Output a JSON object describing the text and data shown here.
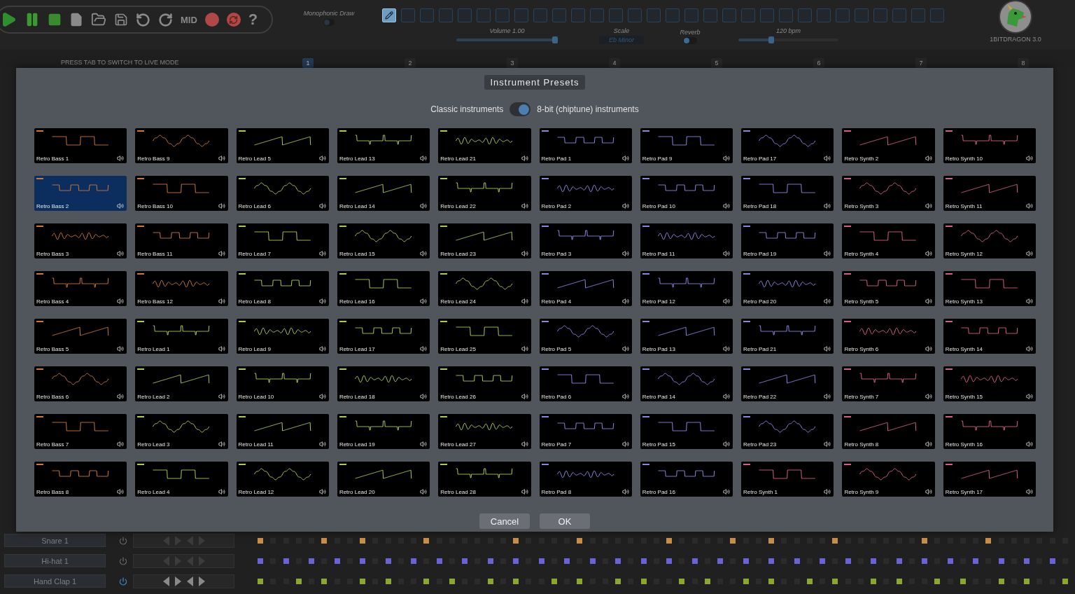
{
  "toolbar": {
    "mid_label": "MID",
    "help_label": "?"
  },
  "monophonic_draw": {
    "label": "Monophonic Draw",
    "on": false
  },
  "steps": [
    {
      "selected": true
    },
    {
      "selected": false
    },
    {
      "selected": false
    },
    {
      "selected": false
    },
    {
      "selected": false
    },
    {
      "selected": false
    },
    {
      "selected": false
    },
    {
      "selected": false
    },
    {
      "selected": false
    },
    {
      "selected": false
    },
    {
      "selected": false
    },
    {
      "selected": false
    },
    {
      "selected": false
    },
    {
      "selected": false
    },
    {
      "selected": false
    },
    {
      "selected": false
    },
    {
      "selected": false
    },
    {
      "selected": false
    },
    {
      "selected": false
    },
    {
      "selected": false
    },
    {
      "selected": false
    },
    {
      "selected": false
    },
    {
      "selected": false
    },
    {
      "selected": false
    },
    {
      "selected": false
    },
    {
      "selected": false
    },
    {
      "selected": false
    },
    {
      "selected": false
    },
    {
      "selected": false
    },
    {
      "selected": false
    }
  ],
  "volume": {
    "label": "Volume 1.00",
    "level": 0.97
  },
  "scale": {
    "label": "Scale",
    "value": "Eb Minor"
  },
  "reverb": {
    "label": "Reverb",
    "on": false
  },
  "tempo": {
    "label": "120 bpm",
    "level": 0.33
  },
  "logo": {
    "caption": "1BITDRAGON 3.0"
  },
  "hint": "PRESS TAB TO SWITCH TO LIVE MODE",
  "bars": [
    {
      "label": "1",
      "selected": true
    },
    {
      "label": "2",
      "selected": false
    },
    {
      "label": "3",
      "selected": false
    },
    {
      "label": "4",
      "selected": false
    },
    {
      "label": "5",
      "selected": false
    },
    {
      "label": "6",
      "selected": false
    },
    {
      "label": "7",
      "selected": false
    },
    {
      "label": "8",
      "selected": false
    }
  ],
  "dialog": {
    "title": "Instrument Presets",
    "mode_switch": {
      "left_label": "Classic instruments",
      "right_label": "8-bit (chiptune) instruments",
      "on": true
    },
    "presets": [
      {
        "name": "Retro Bass 1",
        "selected": false,
        "color": "#c8783c"
      },
      {
        "name": "Retro Bass 9",
        "selected": false,
        "color": "#c8783c"
      },
      {
        "name": "Retro Lead 5",
        "selected": false,
        "color": "#a8cc50"
      },
      {
        "name": "Retro Lead 13",
        "selected": false,
        "color": "#a8cc50"
      },
      {
        "name": "Retro Lead 21",
        "selected": false,
        "color": "#a8cc50"
      },
      {
        "name": "Retro Pad 1",
        "selected": false,
        "color": "#8a86e0"
      },
      {
        "name": "Retro Pad 9",
        "selected": false,
        "color": "#8a86e0"
      },
      {
        "name": "Retro Pad 17",
        "selected": false,
        "color": "#8a86e0"
      },
      {
        "name": "Retro Synth 2",
        "selected": false,
        "color": "#d0608a"
      },
      {
        "name": "Retro Synth 10",
        "selected": false,
        "color": "#d0608a"
      },
      {
        "name": "Retro Bass 2",
        "selected": true,
        "color": "#c8783c"
      },
      {
        "name": "Retro Bass 10",
        "selected": false,
        "color": "#c8783c"
      },
      {
        "name": "Retro Lead 6",
        "selected": false,
        "color": "#a8cc50"
      },
      {
        "name": "Retro Lead 14",
        "selected": false,
        "color": "#a8cc50"
      },
      {
        "name": "Retro Lead 22",
        "selected": false,
        "color": "#a8cc50"
      },
      {
        "name": "Retro Pad 2",
        "selected": false,
        "color": "#8a86e0"
      },
      {
        "name": "Retro Pad 10",
        "selected": false,
        "color": "#8a86e0"
      },
      {
        "name": "Retro Pad 18",
        "selected": false,
        "color": "#8a86e0"
      },
      {
        "name": "Retro Synth 3",
        "selected": false,
        "color": "#d0608a"
      },
      {
        "name": "Retro Synth 11",
        "selected": false,
        "color": "#d0608a"
      },
      {
        "name": "Retro Bass 3",
        "selected": false,
        "color": "#c8783c"
      },
      {
        "name": "Retro Bass 11",
        "selected": false,
        "color": "#c8783c"
      },
      {
        "name": "Retro Lead 7",
        "selected": false,
        "color": "#a8cc50"
      },
      {
        "name": "Retro Lead 15",
        "selected": false,
        "color": "#a8cc50"
      },
      {
        "name": "Retro Lead 23",
        "selected": false,
        "color": "#a8cc50"
      },
      {
        "name": "Retro Pad 3",
        "selected": false,
        "color": "#8a86e0"
      },
      {
        "name": "Retro Pad 11",
        "selected": false,
        "color": "#8a86e0"
      },
      {
        "name": "Retro Pad 19",
        "selected": false,
        "color": "#8a86e0"
      },
      {
        "name": "Retro Synth 4",
        "selected": false,
        "color": "#d0608a"
      },
      {
        "name": "Retro Synth 12",
        "selected": false,
        "color": "#d0608a"
      },
      {
        "name": "Retro Bass 4",
        "selected": false,
        "color": "#c8783c"
      },
      {
        "name": "Retro Bass 12",
        "selected": false,
        "color": "#c8783c"
      },
      {
        "name": "Retro Lead 8",
        "selected": false,
        "color": "#a8cc50"
      },
      {
        "name": "Retro Lead 16",
        "selected": false,
        "color": "#a8cc50"
      },
      {
        "name": "Retro Lead 24",
        "selected": false,
        "color": "#a8cc50"
      },
      {
        "name": "Retro Pad 4",
        "selected": false,
        "color": "#8a86e0"
      },
      {
        "name": "Retro Pad 12",
        "selected": false,
        "color": "#8a86e0"
      },
      {
        "name": "Retro Pad 20",
        "selected": false,
        "color": "#8a86e0"
      },
      {
        "name": "Retro Synth 5",
        "selected": false,
        "color": "#d0608a"
      },
      {
        "name": "Retro Synth 13",
        "selected": false,
        "color": "#d0608a"
      },
      {
        "name": "Retro Bass 5",
        "selected": false,
        "color": "#c8783c"
      },
      {
        "name": "Retro Lead 1",
        "selected": false,
        "color": "#a8cc50"
      },
      {
        "name": "Retro Lead 9",
        "selected": false,
        "color": "#a8cc50"
      },
      {
        "name": "Retro Lead 17",
        "selected": false,
        "color": "#a8cc50"
      },
      {
        "name": "Retro Lead 25",
        "selected": false,
        "color": "#a8cc50"
      },
      {
        "name": "Retro Pad 5",
        "selected": false,
        "color": "#8a86e0"
      },
      {
        "name": "Retro Pad 13",
        "selected": false,
        "color": "#8a86e0"
      },
      {
        "name": "Retro Pad 21",
        "selected": false,
        "color": "#8a86e0"
      },
      {
        "name": "Retro Synth 6",
        "selected": false,
        "color": "#d0608a"
      },
      {
        "name": "Retro Synth 14",
        "selected": false,
        "color": "#d0608a"
      },
      {
        "name": "Retro Bass 6",
        "selected": false,
        "color": "#c8783c"
      },
      {
        "name": "Retro Lead 2",
        "selected": false,
        "color": "#a8cc50"
      },
      {
        "name": "Retro Lead 10",
        "selected": false,
        "color": "#a8cc50"
      },
      {
        "name": "Retro Lead 18",
        "selected": false,
        "color": "#a8cc50"
      },
      {
        "name": "Retro Lead 26",
        "selected": false,
        "color": "#a8cc50"
      },
      {
        "name": "Retro Pad 6",
        "selected": false,
        "color": "#8a86e0"
      },
      {
        "name": "Retro Pad 14",
        "selected": false,
        "color": "#8a86e0"
      },
      {
        "name": "Retro Pad 22",
        "selected": false,
        "color": "#8a86e0"
      },
      {
        "name": "Retro Synth 7",
        "selected": false,
        "color": "#d0608a"
      },
      {
        "name": "Retro Synth 15",
        "selected": false,
        "color": "#d0608a"
      },
      {
        "name": "Retro Bass 7",
        "selected": false,
        "color": "#c8783c"
      },
      {
        "name": "Retro Lead 3",
        "selected": false,
        "color": "#a8cc50"
      },
      {
        "name": "Retro Lead 11",
        "selected": false,
        "color": "#a8cc50"
      },
      {
        "name": "Retro Lead 19",
        "selected": false,
        "color": "#a8cc50"
      },
      {
        "name": "Retro Lead 27",
        "selected": false,
        "color": "#a8cc50"
      },
      {
        "name": "Retro Pad 7",
        "selected": false,
        "color": "#8a86e0"
      },
      {
        "name": "Retro Pad 15",
        "selected": false,
        "color": "#8a86e0"
      },
      {
        "name": "Retro Pad 23",
        "selected": false,
        "color": "#8a86e0"
      },
      {
        "name": "Retro Synth 8",
        "selected": false,
        "color": "#d0608a"
      },
      {
        "name": "Retro Synth 16",
        "selected": false,
        "color": "#d0608a"
      },
      {
        "name": "Retro Bass 8",
        "selected": false,
        "color": "#c8783c"
      },
      {
        "name": "Retro Lead 4",
        "selected": false,
        "color": "#a8cc50"
      },
      {
        "name": "Retro Lead 12",
        "selected": false,
        "color": "#a8cc50"
      },
      {
        "name": "Retro Lead 20",
        "selected": false,
        "color": "#a8cc50"
      },
      {
        "name": "Retro Lead 28",
        "selected": false,
        "color": "#a8cc50"
      },
      {
        "name": "Retro Pad 8",
        "selected": false,
        "color": "#8a86e0"
      },
      {
        "name": "Retro Pad 16",
        "selected": false,
        "color": "#8a86e0"
      },
      {
        "name": "Retro Synth 1",
        "selected": false,
        "color": "#d0608a"
      },
      {
        "name": "Retro Synth 9",
        "selected": false,
        "color": "#d0608a"
      },
      {
        "name": "Retro Synth 17",
        "selected": false,
        "color": "#d0608a"
      }
    ],
    "buttons": [
      "Cancel",
      "OK"
    ]
  },
  "tracks": [
    {
      "name": "Snare 1",
      "on": false,
      "color": "#c8904a",
      "steps": [
        true,
        false,
        false,
        false,
        false,
        true,
        false,
        false,
        true,
        false,
        false,
        false,
        false,
        true,
        false,
        false,
        false,
        false,
        false,
        false,
        true,
        false,
        false,
        false,
        false,
        true,
        false,
        false,
        false,
        false,
        false,
        false,
        true,
        false,
        false,
        false,
        false,
        true,
        false,
        false,
        true,
        false,
        false,
        false,
        false,
        true,
        false,
        false,
        false,
        false,
        false,
        false,
        true,
        false,
        false,
        false,
        false,
        true,
        false,
        false,
        false,
        false,
        false,
        false
      ]
    },
    {
      "name": "Hi-hat 1",
      "on": false,
      "color": "#6a62d8",
      "steps": [
        true,
        false,
        true,
        false,
        true,
        false,
        true,
        false,
        true,
        false,
        true,
        false,
        true,
        false,
        true,
        false,
        true,
        false,
        true,
        false,
        true,
        false,
        true,
        false,
        true,
        false,
        true,
        false,
        true,
        false,
        true,
        false,
        true,
        false,
        true,
        false,
        true,
        false,
        true,
        false,
        true,
        false,
        true,
        false,
        true,
        false,
        true,
        false,
        true,
        false,
        true,
        false,
        true,
        false,
        true,
        false,
        true,
        false,
        true,
        false,
        true,
        false,
        true,
        false
      ]
    },
    {
      "name": "Hand Clap 1",
      "on": true,
      "color": "#8aa830",
      "steps": [
        true,
        false,
        false,
        true,
        false,
        true,
        false,
        false,
        true,
        false,
        true,
        false,
        false,
        true,
        false,
        true,
        false,
        false,
        true,
        false,
        true,
        false,
        false,
        true,
        false,
        true,
        false,
        false,
        true,
        false,
        true,
        false,
        false,
        true,
        false,
        true,
        false,
        false,
        true,
        false,
        true,
        false,
        false,
        true,
        false,
        true,
        false,
        false,
        true,
        false,
        true,
        false,
        false,
        true,
        false,
        true,
        false,
        false,
        true,
        false,
        true,
        false,
        false,
        true
      ]
    }
  ]
}
